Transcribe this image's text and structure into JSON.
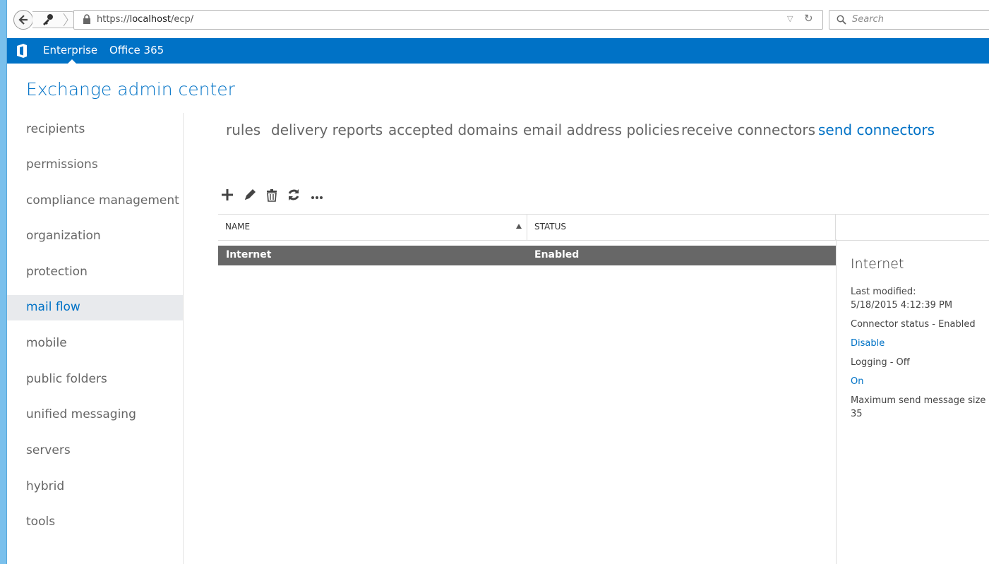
{
  "browser": {
    "url_prefix": "https://",
    "url_host": "localhost",
    "url_path": "/ecp/",
    "search_placeholder": "Search"
  },
  "topbar": {
    "items": [
      "Enterprise",
      "Office 365"
    ],
    "color": "#0072c6"
  },
  "page_title": "Exchange admin center",
  "leftnav": {
    "items": [
      {
        "label": "recipients"
      },
      {
        "label": "permissions"
      },
      {
        "label": "compliance management"
      },
      {
        "label": "organization"
      },
      {
        "label": "protection"
      },
      {
        "label": "mail flow",
        "active": true
      },
      {
        "label": "mobile"
      },
      {
        "label": "public folders"
      },
      {
        "label": "unified messaging"
      },
      {
        "label": "servers"
      },
      {
        "label": "hybrid"
      },
      {
        "label": "tools"
      }
    ]
  },
  "tabs": [
    {
      "label": "rules"
    },
    {
      "label": "delivery reports"
    },
    {
      "label": "accepted domains"
    },
    {
      "label": "email address policies"
    },
    {
      "label": "receive connectors"
    },
    {
      "label": "send connectors",
      "active": true
    }
  ],
  "toolbar": [
    "add-icon",
    "edit-icon",
    "delete-icon",
    "refresh-icon",
    "more-icon"
  ],
  "table": {
    "columns": [
      "NAME",
      "STATUS"
    ],
    "rows": [
      {
        "name": "Internet",
        "status": "Enabled",
        "selected": true
      }
    ]
  },
  "details": {
    "title": "Internet",
    "last_modified_label": "Last modified:",
    "last_modified_value": "5/18/2015 4:12:39 PM",
    "connector_status": "Connector status - Enabled",
    "disable_link": "Disable",
    "logging": "Logging - Off",
    "on_link": "On",
    "max_size_label": "Maximum send message size (",
    "max_size_value": "35"
  }
}
